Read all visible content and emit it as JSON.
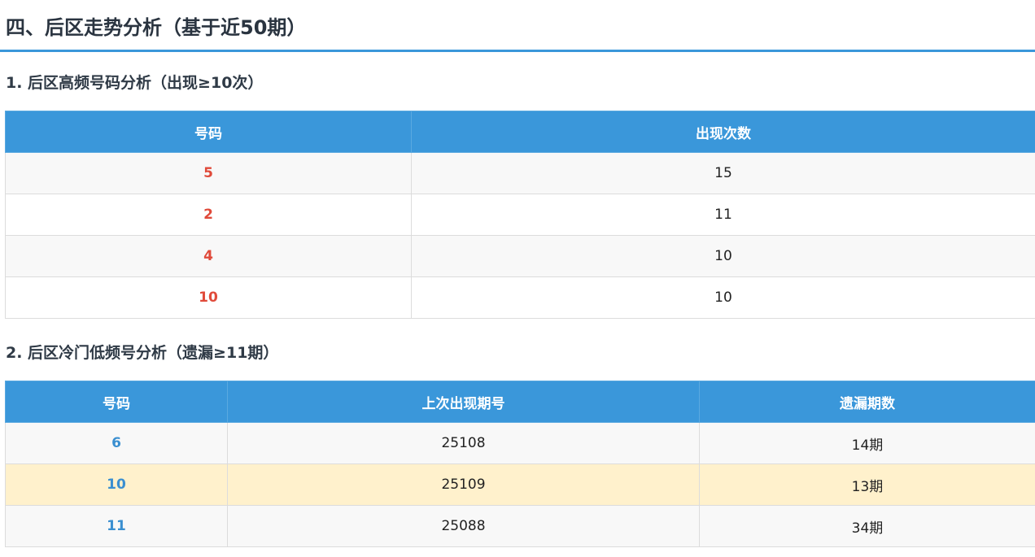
{
  "main_title": "四、后区走势分析（基于近50期）",
  "section1": {
    "title": "1. 后区高频号码分析（出现≥10次）",
    "headers": [
      "号码",
      "出现次数"
    ],
    "rows": [
      {
        "number": "5",
        "count": "15"
      },
      {
        "number": "2",
        "count": "11"
      },
      {
        "number": "4",
        "count": "10"
      },
      {
        "number": "10",
        "count": "10"
      }
    ]
  },
  "section2": {
    "title": "2. 后区冷门低频号分析（遗漏≥11期）",
    "headers": [
      "号码",
      "上次出现期号",
      "遗漏期数"
    ],
    "rows": [
      {
        "number": "6",
        "last_issue": "25108",
        "missed": "14期"
      },
      {
        "number": "10",
        "last_issue": "25109",
        "missed": "13期"
      },
      {
        "number": "11",
        "last_issue": "25088",
        "missed": "34期"
      }
    ]
  },
  "colors": {
    "accent": "#3a97da",
    "hot_number": "#e04a3a",
    "cold_number": "#3a8fd0",
    "highlight_row": "#fff1cc"
  }
}
